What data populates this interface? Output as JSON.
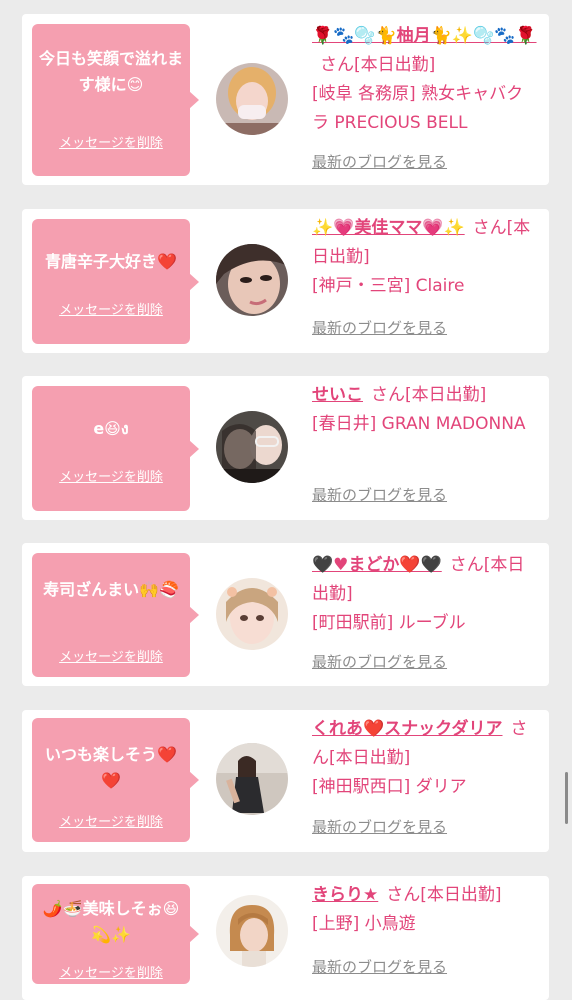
{
  "colors": {
    "background": "#ebebeb",
    "card": "#ffffff",
    "bubble": "#f59fb0",
    "accent": "#e2457a",
    "muted": "#8c8c8c"
  },
  "delete_label": "メッセージを削除",
  "blog_label": "最新のブログを見る",
  "san_label": "さん",
  "cards": [
    {
      "message": "今日も笑顔で溢れます様に😊",
      "cast_name": "🌹🐾🫧🐈柚月🐈✨🫧🐾🌹",
      "status": "[本日出勤]",
      "shop": "[岐阜 各務原] 熟女キャバクラ PRECIOUS BELL",
      "avatar_icon": "avatar-photo-blonde-woman-mask"
    },
    {
      "message": "青唐辛子大好き❤️",
      "cast_name": "✨💗美佳ママ💗✨",
      "status": "[本日出勤]",
      "shop": "[神戸・三宮] Claire",
      "avatar_icon": "avatar-photo-woman-closeup"
    },
    {
      "message": "e😆ง",
      "cast_name": "せいこ",
      "status": "[本日出勤]",
      "shop": "[春日井] GRAN MADONNA",
      "avatar_icon": "avatar-photo-two-women"
    },
    {
      "message": "寿司ざんまい🙌🍣",
      "cast_name": "🖤♥まどか❤️🖤",
      "status": "[本日出勤]",
      "shop": "[町田駅前] ルーブル",
      "avatar_icon": "avatar-photo-woman-filter"
    },
    {
      "message": "いつも楽しそう❤️❤️",
      "cast_name": "くれあ❤️スナックダリア",
      "status": "[本日出勤]",
      "shop": "[神田駅西口] ダリア",
      "avatar_icon": "avatar-photo-woman-posing"
    },
    {
      "message": "🌶️🍜美味しそぉ😆💫✨",
      "cast_name": "きらり★",
      "status": "[本日出勤]",
      "shop": "[上野] 小鳥遊",
      "avatar_icon": "avatar-photo-woman-bob-hair"
    }
  ]
}
